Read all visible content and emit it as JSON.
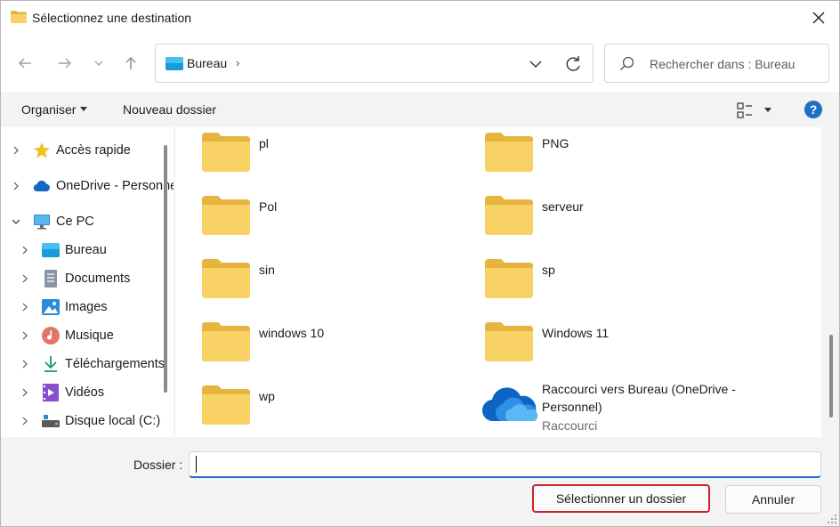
{
  "window": {
    "title": "Sélectionnez une destination"
  },
  "nav": {
    "address_location": "Bureau",
    "address_chevron": "›",
    "search_placeholder": "Rechercher dans : Bureau"
  },
  "toolbar": {
    "organise_label": "Organiser",
    "new_folder_label": "Nouveau dossier",
    "help_label": "?"
  },
  "sidebar": {
    "items": [
      {
        "label": "Accès rapide",
        "icon": "star-icon",
        "expanded": false
      },
      {
        "label": "OneDrive - Personnel",
        "icon": "cloud-icon",
        "expanded": false
      },
      {
        "label": "Ce PC",
        "icon": "monitor-icon",
        "expanded": true
      },
      {
        "label": "Bureau",
        "icon": "desktop-icon",
        "expanded": false
      },
      {
        "label": "Documents",
        "icon": "document-icon",
        "expanded": false
      },
      {
        "label": "Images",
        "icon": "image-icon",
        "expanded": false
      },
      {
        "label": "Musique",
        "icon": "music-icon",
        "expanded": false
      },
      {
        "label": "Téléchargements",
        "icon": "download-icon",
        "expanded": false
      },
      {
        "label": "Vidéos",
        "icon": "video-icon",
        "expanded": false
      },
      {
        "label": "Disque local (C:)",
        "icon": "drive-icon",
        "expanded": false
      }
    ]
  },
  "content": {
    "items": [
      {
        "name": "pl",
        "type": "folder"
      },
      {
        "name": "PNG",
        "type": "folder"
      },
      {
        "name": "Pol",
        "type": "folder"
      },
      {
        "name": "serveur",
        "type": "folder"
      },
      {
        "name": "sin",
        "type": "folder"
      },
      {
        "name": "sp",
        "type": "folder"
      },
      {
        "name": "windows 10",
        "type": "folder"
      },
      {
        "name": "Windows 11",
        "type": "folder"
      },
      {
        "name": "wp",
        "type": "folder"
      },
      {
        "name_line1": "Raccourci vers Bureau (OneDrive -",
        "name_line2": "Personnel)",
        "subtitle": "Raccourci",
        "type": "shortcut"
      }
    ]
  },
  "footer": {
    "folder_label": "Dossier :",
    "folder_value": "",
    "select_button": "Sélectionner un dossier",
    "cancel_button": "Annuler"
  },
  "colors": {
    "accent": "#1f6fc5",
    "highlight_border": "#c8232a",
    "folder_yellow": "#f8d264"
  }
}
